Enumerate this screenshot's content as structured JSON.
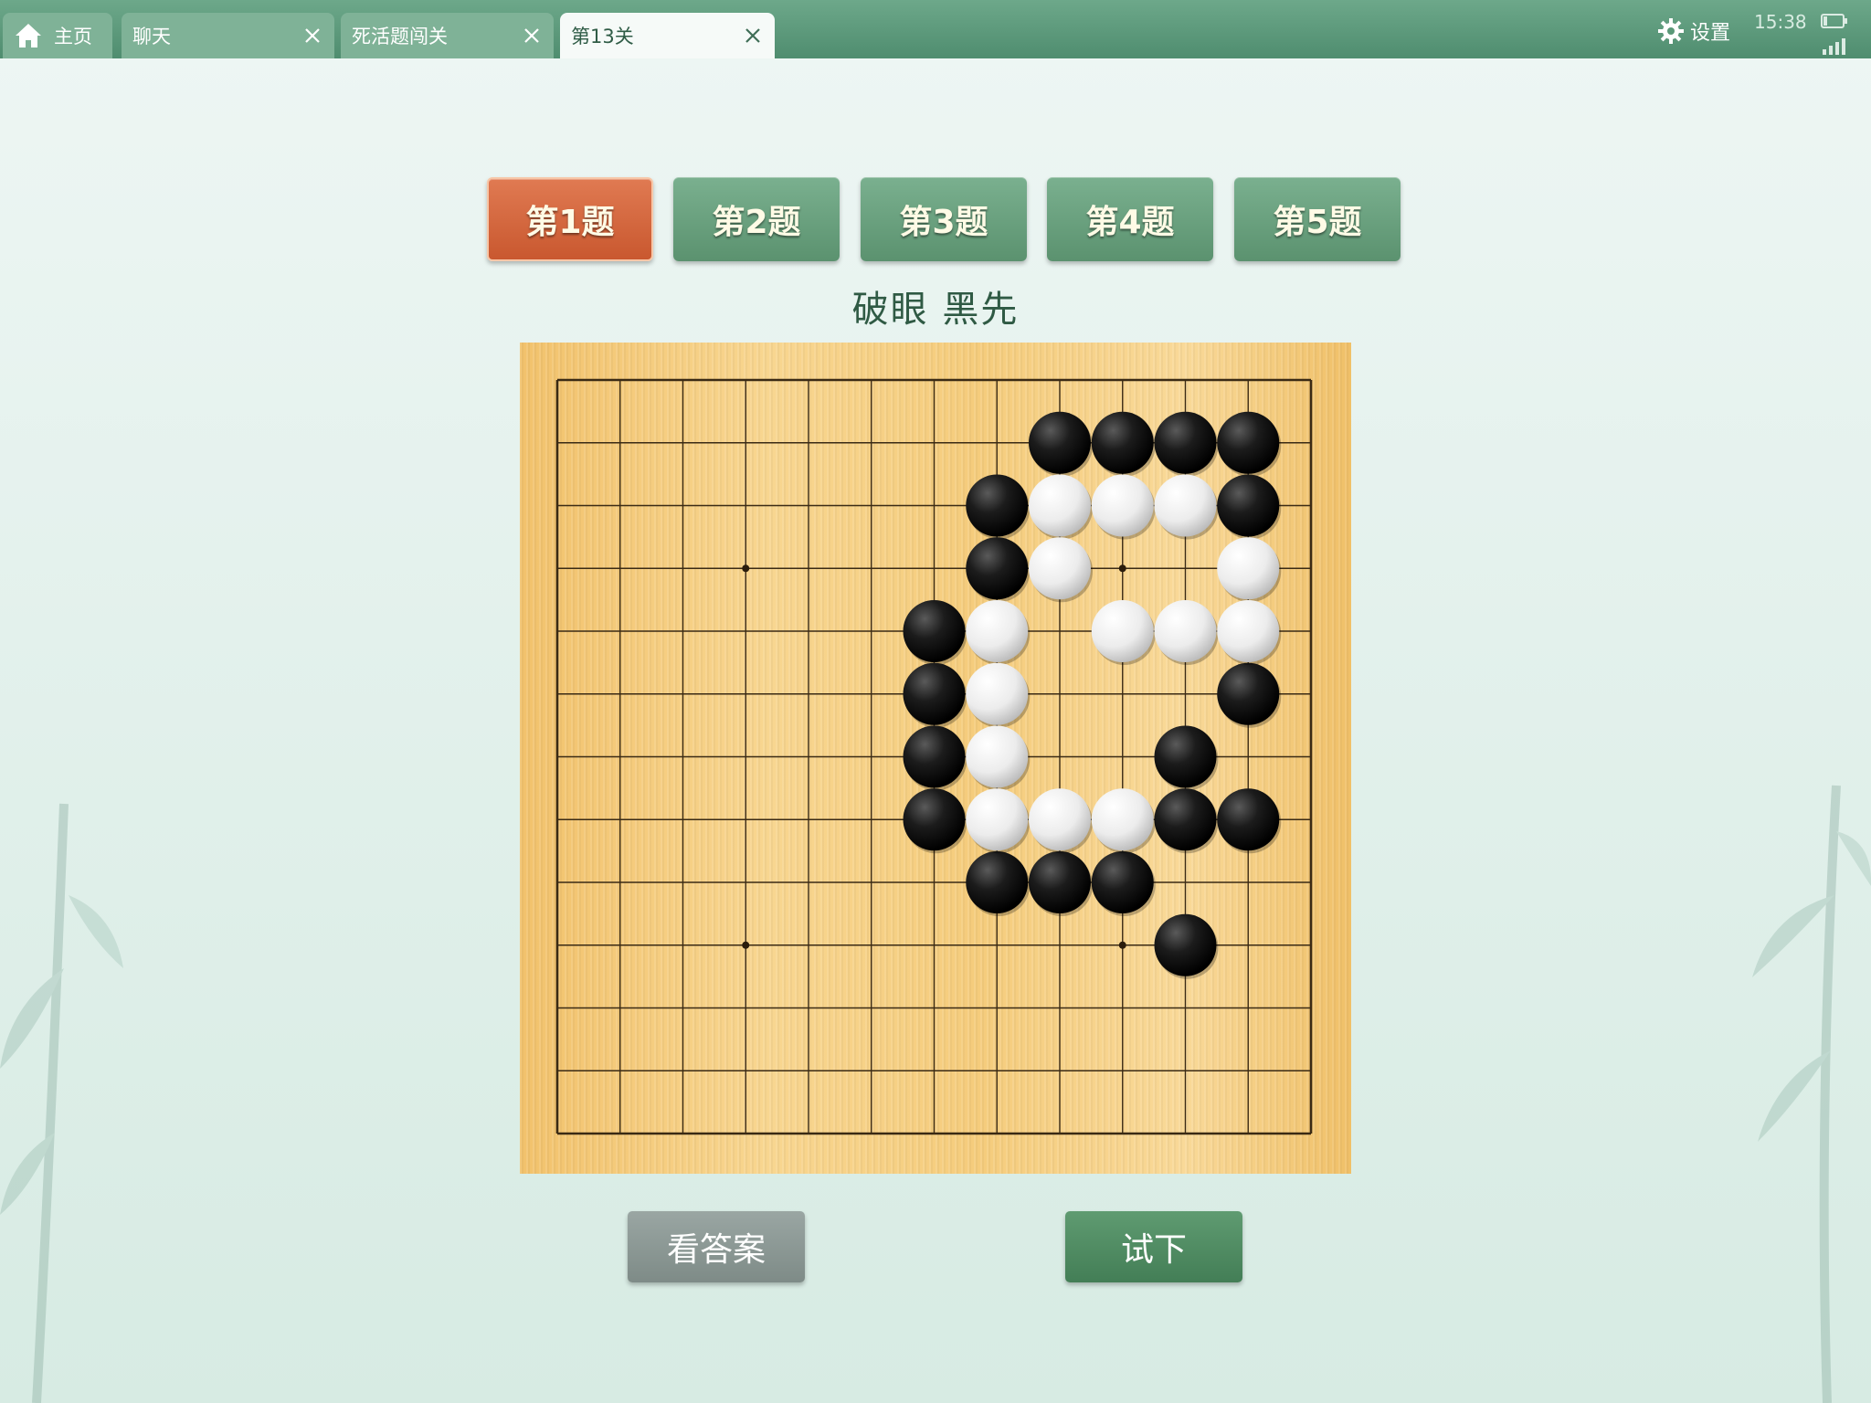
{
  "tabs": [
    {
      "label": "主页",
      "icon": "home-icon",
      "active": false,
      "closable": false
    },
    {
      "label": "聊天",
      "active": false,
      "closable": true
    },
    {
      "label": "死活题闯关",
      "active": false,
      "closable": true
    },
    {
      "label": "第13关",
      "active": true,
      "closable": true
    }
  ],
  "status": {
    "settings_label": "设置",
    "time": "15:38"
  },
  "problems": [
    {
      "label": "第1题",
      "active": true
    },
    {
      "label": "第2题",
      "active": false
    },
    {
      "label": "第3题",
      "active": false
    },
    {
      "label": "第4题",
      "active": false
    },
    {
      "label": "第5题",
      "active": false
    }
  ],
  "subtitle": "破眼   黑先",
  "board": {
    "size": 13,
    "star_points": [
      [
        3,
        3
      ],
      [
        9,
        3
      ],
      [
        3,
        9
      ],
      [
        9,
        9
      ]
    ],
    "black": [
      [
        8,
        1
      ],
      [
        9,
        1
      ],
      [
        10,
        1
      ],
      [
        11,
        1
      ],
      [
        7,
        2
      ],
      [
        11,
        2
      ],
      [
        7,
        3
      ],
      [
        6,
        4
      ],
      [
        6,
        5
      ],
      [
        11,
        5
      ],
      [
        6,
        6
      ],
      [
        10,
        6
      ],
      [
        6,
        7
      ],
      [
        10,
        7
      ],
      [
        11,
        7
      ],
      [
        7,
        8
      ],
      [
        8,
        8
      ],
      [
        9,
        8
      ],
      [
        10,
        9
      ]
    ],
    "white": [
      [
        8,
        2
      ],
      [
        9,
        2
      ],
      [
        10,
        2
      ],
      [
        8,
        3
      ],
      [
        11,
        3
      ],
      [
        7,
        4
      ],
      [
        9,
        4
      ],
      [
        10,
        4
      ],
      [
        11,
        4
      ],
      [
        7,
        5
      ],
      [
        7,
        6
      ],
      [
        7,
        7
      ],
      [
        8,
        7
      ],
      [
        9,
        7
      ]
    ]
  },
  "buttons": {
    "answer": "看答案",
    "try": "试下"
  },
  "colors": {
    "topbar": "#5a9878",
    "active_problem": "#d4653c",
    "problem": "#6aa27f",
    "board": "#f5cd7d"
  }
}
